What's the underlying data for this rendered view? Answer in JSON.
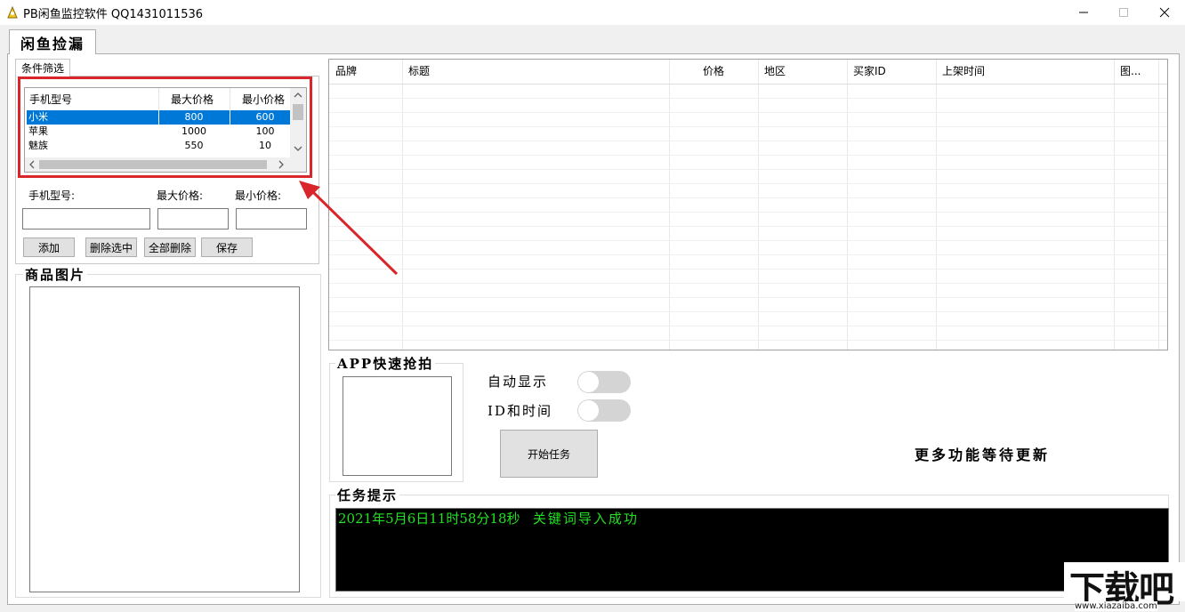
{
  "window": {
    "title": "PB闲鱼监控软件 QQ1431011536",
    "controls": {
      "minimize": "—",
      "maximize": "☐",
      "close": "✕"
    }
  },
  "tabs": {
    "main": "闲鱼捡漏",
    "filter": "条件筛选"
  },
  "phone_list": {
    "columns": [
      "手机型号",
      "最大价格",
      "最小价格"
    ],
    "rows": [
      {
        "model": "小米",
        "max": "800",
        "min": "600",
        "selected": true
      },
      {
        "model": "苹果",
        "max": "1000",
        "min": "100"
      },
      {
        "model": "魅族",
        "max": "550",
        "min": "10"
      }
    ]
  },
  "form": {
    "model_label": "手机型号:",
    "max_label": "最大价格:",
    "min_label": "最小价格:",
    "model_value": "",
    "max_value": "",
    "min_value": ""
  },
  "buttons": {
    "add": "添加",
    "delete_selected": "删除选中",
    "delete_all": "全部删除",
    "save": "保存",
    "start_task": "开始任务"
  },
  "product_image": {
    "title": "商品图片"
  },
  "product_grid": {
    "columns": [
      "品牌",
      "标题",
      "价格",
      "地区",
      "买家ID",
      "上架时间",
      "图..."
    ]
  },
  "app_quick": {
    "title": "APP快速抢拍"
  },
  "toggles": {
    "auto_display": {
      "label": "自动显示",
      "on": false
    },
    "id_time": {
      "label": "ID和时间",
      "on": false
    }
  },
  "more_features": "更多功能等待更新",
  "task_hint": {
    "title": "任务提示",
    "log_time": "2021年5月6日11时58分18秒",
    "log_msg": "关键词导入成功"
  },
  "watermark": {
    "logo": "下载吧",
    "url": "www.xiazaiba.com"
  },
  "colors": {
    "highlight": "#d8262a",
    "selection": "#0078d7",
    "log_text": "#22e022",
    "arrow": "#d8262a"
  }
}
